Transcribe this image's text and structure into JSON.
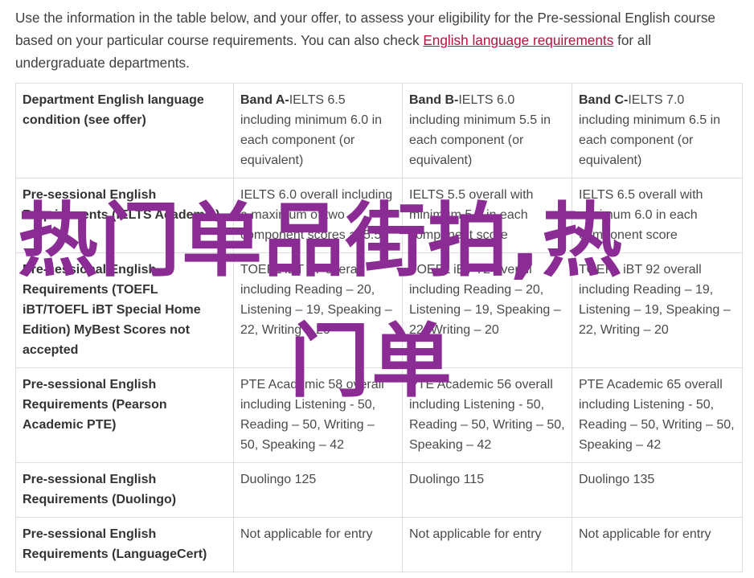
{
  "intro": {
    "text_before": "Use the information in the table below, and your offer, to assess your eligibility for the Pre-sessional English course based on your particular course requirements. You can also check ",
    "link": "English language requirements",
    "text_after": " for all undergraduate departments."
  },
  "table": {
    "header": {
      "col0": "Department English language condition (see offer)",
      "bands": [
        {
          "name": "Band A-",
          "rest": "IELTS 6.5 including minimum 6.0 in each component (or equivalent)"
        },
        {
          "name": "Band B-",
          "rest": "IELTS 6.0 including minimum 5.5 in each component (or equivalent)"
        },
        {
          "name": "Band C-",
          "rest": "IELTS 7.0 including minimum 6.5 in each component (or equivalent)"
        }
      ]
    },
    "rows": [
      {
        "label": "Pre-sessional English Requirements (IELTS Academic)",
        "cells": [
          "IELTS 6.0 overall including a maximum of two component scores at 5.5",
          "IELTS 5.5 overall with minimum 5.5 in each component score",
          "IELTS 6.5 overall with minimum 6.0 in each component score"
        ]
      },
      {
        "label": "Pre-sessional English Requirements (TOEFL iBT/TOEFL iBT Special Home Edition) MyBest Scores not accepted",
        "cells": [
          "TOEFL iBT 87 overall including Reading – 20, Listening – 19, Speaking – 22, Writing – 20",
          "TOEFL iBT 72 overall including Reading – 20, Listening – 19, Speaking – 22, Writing – 20",
          "TOEFL iBT 92 overall including Reading – 19, Listening – 19, Speaking – 22, Writing – 20"
        ]
      },
      {
        "label": "Pre-sessional English Requirements (Pearson Academic PTE)",
        "cells": [
          "PTE Academic 58 overall including Listening - 50, Reading – 50, Writing – 50, Speaking – 42",
          "PTE Academic 56 overall including Listening - 50, Reading – 50, Writing – 50, Speaking – 42",
          "PTE Academic 65 overall including Listening - 50, Reading – 50, Writing – 50, Speaking – 42"
        ]
      },
      {
        "label": "Pre-sessional English Requirements (Duolingo)",
        "cells": [
          "Duolingo 125",
          "Duolingo 115",
          "Duolingo 135"
        ]
      },
      {
        "label": "Pre-sessional English Requirements (LanguageCert)",
        "cells": [
          "Not applicable for entry",
          "Not applicable for entry",
          "Not applicable for entry"
        ]
      }
    ]
  },
  "watermark": {
    "line1": "热门单品街拍,热",
    "line2": "门单",
    "color": "#8a2c93"
  }
}
